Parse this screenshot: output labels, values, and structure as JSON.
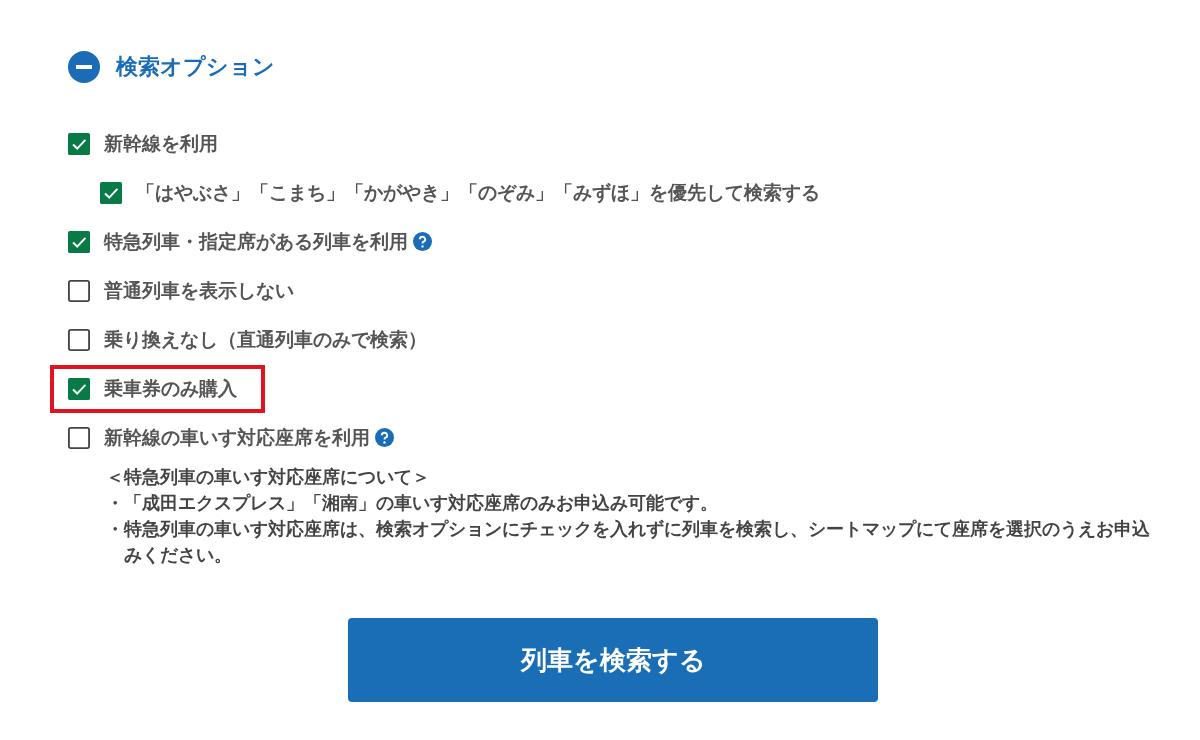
{
  "section": {
    "title": "検索オプション",
    "expanded": true
  },
  "options": [
    {
      "label": "新幹線を利用",
      "checked": true,
      "help": false,
      "highlighted": false,
      "children": [
        {
          "label": "「はやぶさ」「こまち」「かがやき」「のぞみ」「みずほ」を優先して検索する",
          "checked": true,
          "help": false,
          "highlighted": false
        }
      ]
    },
    {
      "label": "特急列車・指定席がある列車を利用",
      "checked": true,
      "help": true,
      "highlighted": false
    },
    {
      "label": "普通列車を表示しない",
      "checked": false,
      "help": false,
      "highlighted": false
    },
    {
      "label": "乗り換えなし（直通列車のみで検索）",
      "checked": false,
      "help": false,
      "highlighted": false
    },
    {
      "label": "乗車券のみ購入",
      "checked": true,
      "help": false,
      "highlighted": true
    },
    {
      "label": "新幹線の車いす対応座席を利用",
      "checked": false,
      "help": true,
      "highlighted": false
    }
  ],
  "notes": {
    "title": "＜特急列車の車いす対応座席について＞",
    "items": [
      "・「成田エクスプレス」「湘南」の車いす対応座席のみお申込み可能です。",
      "・特急列車の車いす対応座席は、検索オプションにチェックを入れずに列車を検索し、シートマップにて座席を選択のうえお申込みください。"
    ]
  },
  "search_button": "列車を検索する"
}
